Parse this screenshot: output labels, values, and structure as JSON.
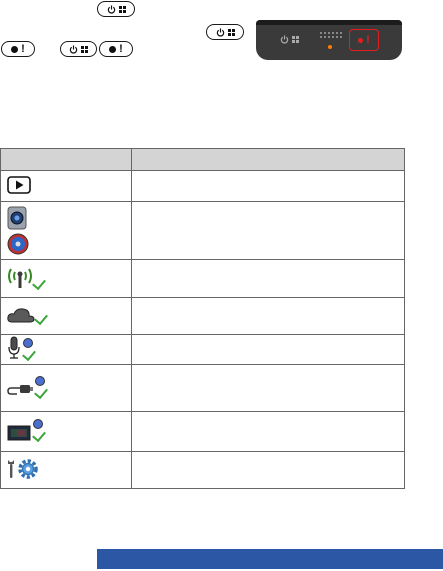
{
  "colors": {
    "header_bg": "#d4d4d4",
    "band": "#2b57a4",
    "check_green": "#3aa53a",
    "record_red": "#e02020",
    "led_orange": "#ff7a00"
  },
  "table": {
    "headers": [
      "",
      ""
    ],
    "rows": [
      {
        "icon": "play-icon",
        "text": ""
      },
      {
        "icon": "camera-status-icon",
        "text": ""
      },
      {
        "icon": "wifi-connected-icon",
        "text": ""
      },
      {
        "icon": "cloud-connected-icon",
        "text": ""
      },
      {
        "icon": "microphone-on-icon",
        "text": ""
      },
      {
        "icon": "power-cable-connected-icon",
        "text": ""
      },
      {
        "icon": "memory-card-ok-icon",
        "text": ""
      },
      {
        "icon": "settings-icon",
        "text": ""
      }
    ]
  }
}
